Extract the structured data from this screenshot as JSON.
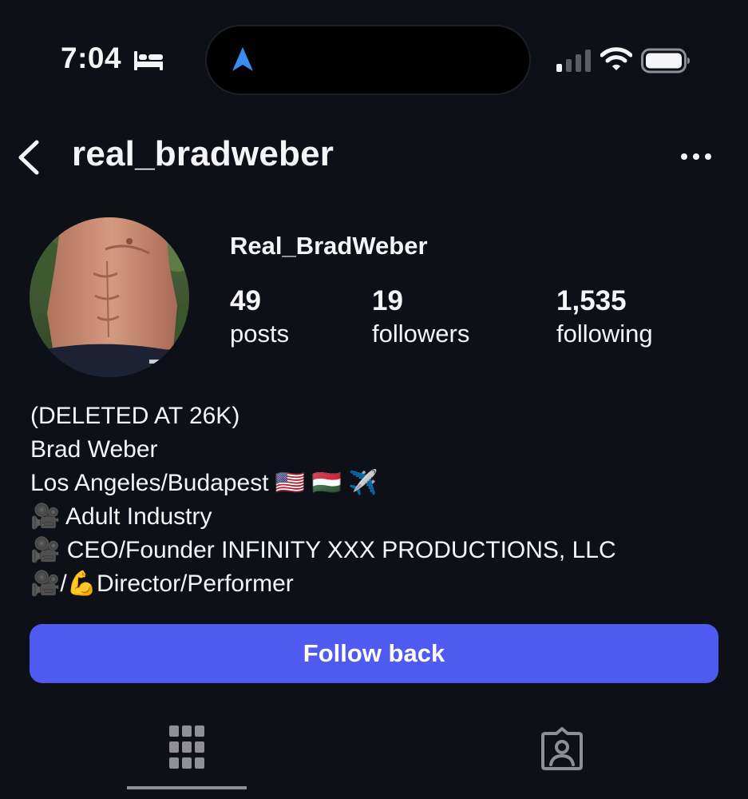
{
  "status_bar": {
    "time": "7:04",
    "icons": [
      "bed-icon",
      "location-arrow-icon",
      "cellular-signal-icon",
      "wifi-icon",
      "battery-icon"
    ]
  },
  "header": {
    "username": "real_bradweber",
    "back_icon": "chevron-left-icon",
    "more_icon": "more-horizontal-icon"
  },
  "profile": {
    "name": "Real_BradWeber",
    "stats": [
      {
        "value": "49",
        "label": "posts"
      },
      {
        "value": "19",
        "label": "followers"
      },
      {
        "value": "1,535",
        "label": "following"
      }
    ],
    "bio": [
      "(DELETED AT 26K)",
      "Brad Weber",
      "Los Angeles/Budapest 🇺🇸 🇭🇺 ✈️",
      "🎥 Adult Industry",
      "🎥 CEO/Founder INFINITY XXX PRODUCTIONS, LLC",
      "🎥/💪Director/Performer"
    ]
  },
  "actions": {
    "follow_back": "Follow back"
  },
  "tabs": [
    {
      "icon": "grid-icon",
      "active": true
    },
    {
      "icon": "tagged-person-icon",
      "active": false
    }
  ],
  "colors": {
    "background": "#0d1117",
    "accent": "#4f5bf0",
    "text": "#f5f5f7",
    "muted": "#8e8e93"
  }
}
